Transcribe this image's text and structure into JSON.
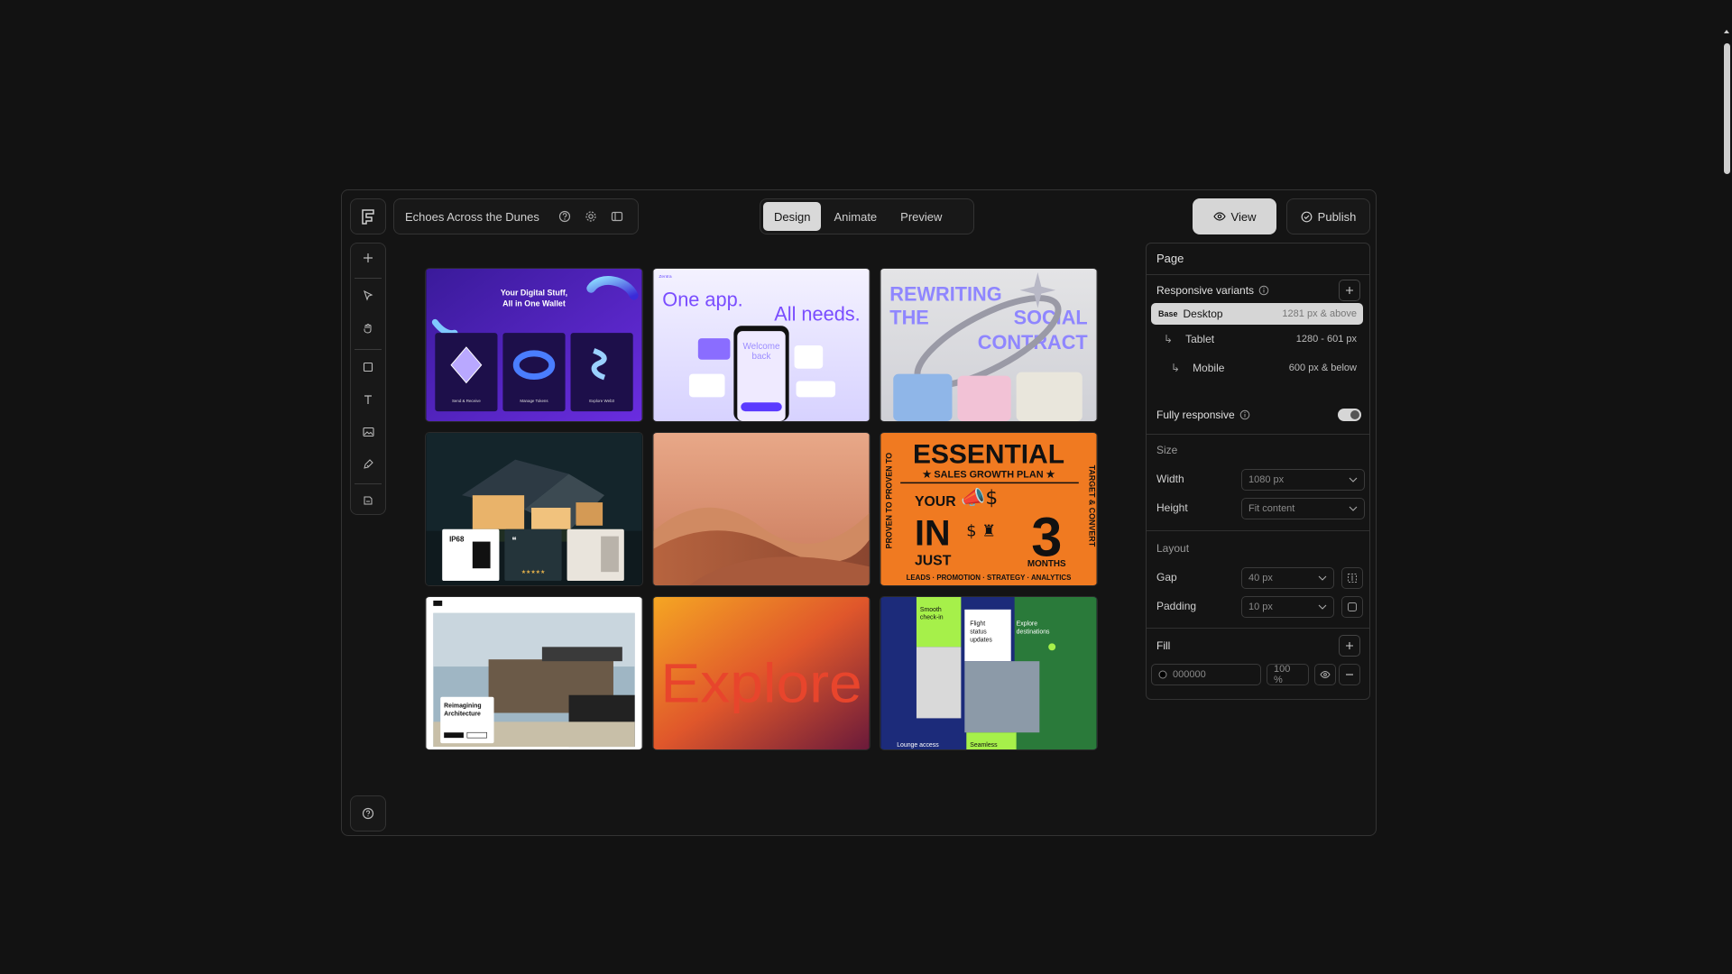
{
  "project": {
    "title": "Echoes Across the Dunes"
  },
  "tabs": [
    {
      "label": "Design",
      "active": true
    },
    {
      "label": "Animate",
      "active": false
    },
    {
      "label": "Preview",
      "active": false
    }
  ],
  "actions": {
    "view": "View",
    "publish": "Publish"
  },
  "cards": {
    "wallet": {
      "title_line1": "Your Digital Stuff,",
      "title_line2": "All in One Wallet",
      "c1": "Send & Receive",
      "c2": "Manage Tokens",
      "c3": "Explore Web3"
    },
    "oneapp": {
      "left": "One app.",
      "right": "All needs.",
      "brand": "Zentra",
      "phone_line1": "Welcome",
      "phone_line2": "back"
    },
    "social": {
      "line1": "REWRITING",
      "line2": "THE",
      "line3": "SOCIAL",
      "line4": "CONTRACT"
    },
    "house": {
      "badge": "IP68"
    },
    "essential": {
      "title": "ESSENTIAL",
      "sub": "★ SALES GROWTH PLAN ★",
      "your": "YOUR",
      "in": "IN",
      "just": "JUST",
      "num": "3",
      "months": "MONTHS",
      "bottom": "LEADS · PROMOTION · STRATEGY · ANALYTICS",
      "left": "PROVEN TO PROVEN TO",
      "right": "TARGET & CONVERT"
    },
    "arch": {
      "line1": "Reimagining",
      "line2": "Architecture"
    },
    "explore": {
      "word": "Explore"
    },
    "travel": {
      "t1a": "Smooth",
      "t1b": "check-in",
      "t2a": "Flight",
      "t2b": "status",
      "t2c": "updates",
      "t3a": "Explore",
      "t3b": "destinations",
      "t4": "Lounge access",
      "t5": "Seamless"
    }
  },
  "panel": {
    "title": "Page",
    "responsive_label": "Responsive variants",
    "variants": [
      {
        "tag": "Base",
        "name": "Desktop",
        "range": "1281 px & above"
      },
      {
        "tag": "",
        "name": "Tablet",
        "range": "1280 - 601 px"
      },
      {
        "tag": "",
        "name": "Mobile",
        "range": "600 px & below"
      }
    ],
    "fully_responsive": "Fully responsive",
    "size_label": "Size",
    "width_label": "Width",
    "width_value": "1080 px",
    "height_label": "Height",
    "height_value": "Fit content",
    "layout_label": "Layout",
    "gap_label": "Gap",
    "gap_value": "40 px",
    "padding_label": "Padding",
    "padding_value": "10 px",
    "fill_label": "Fill",
    "fill_hex": "000000",
    "fill_opacity": "100 %"
  }
}
